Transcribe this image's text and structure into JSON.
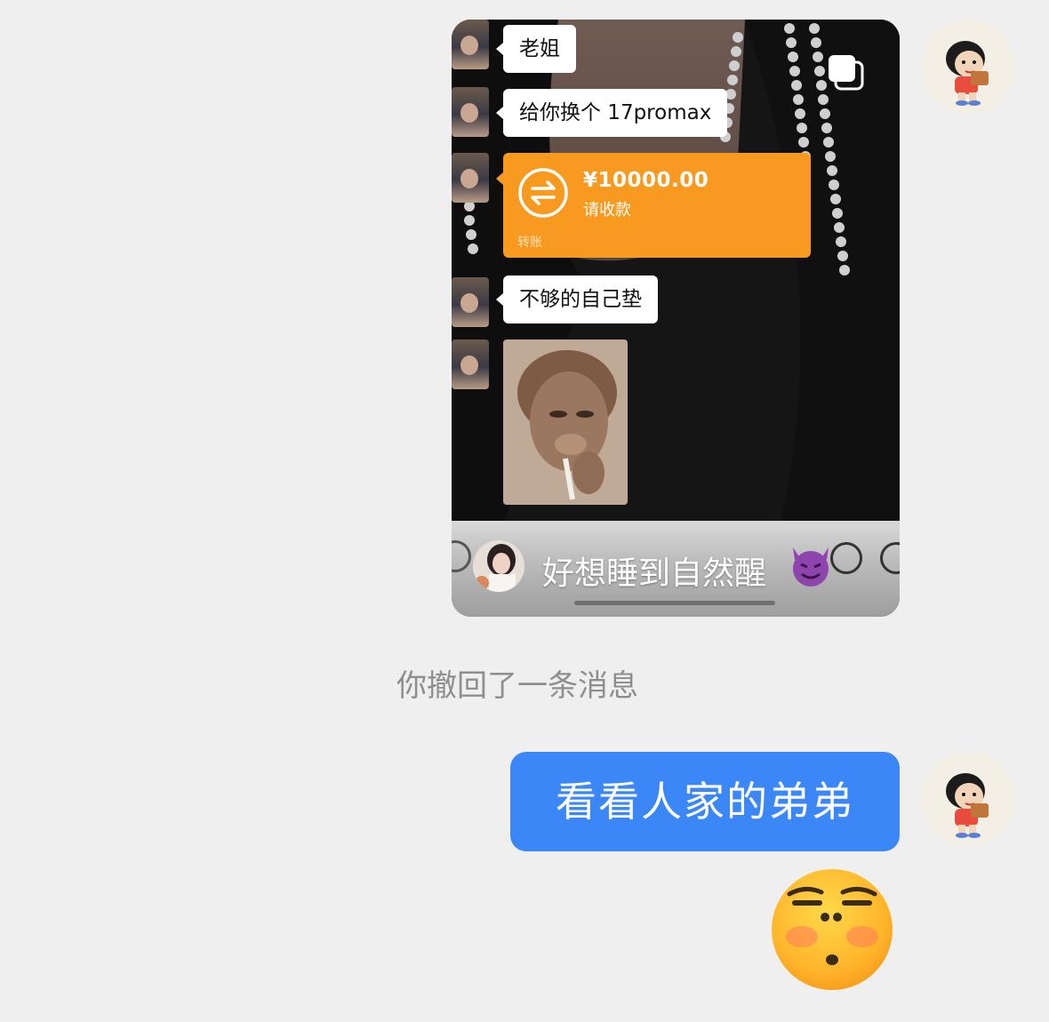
{
  "image_card": {
    "messages": [
      {
        "text": "老姐"
      },
      {
        "text": "给你换个 17promax"
      },
      {
        "text": "不够的自己垫"
      }
    ],
    "transfer": {
      "amount": "¥10000.00",
      "status": "请收款",
      "type_label": "转账"
    },
    "draft_text": "好想睡到自然醒"
  },
  "system_notice": "你撤回了一条消息",
  "outgoing_message": "看看人家的弟弟",
  "icons": {
    "copy": "copy-icon",
    "transfer": "transfer-arrows-icon",
    "devil": "smiling-devil-emoji",
    "emoji_button": "smiley-icon",
    "plus_button": "plus-icon",
    "sticker": "unamused-face-emoji"
  },
  "colors": {
    "outgoing_bubble": "#3b87f7",
    "transfer_card": "#f79a1f",
    "background": "#efefef"
  }
}
